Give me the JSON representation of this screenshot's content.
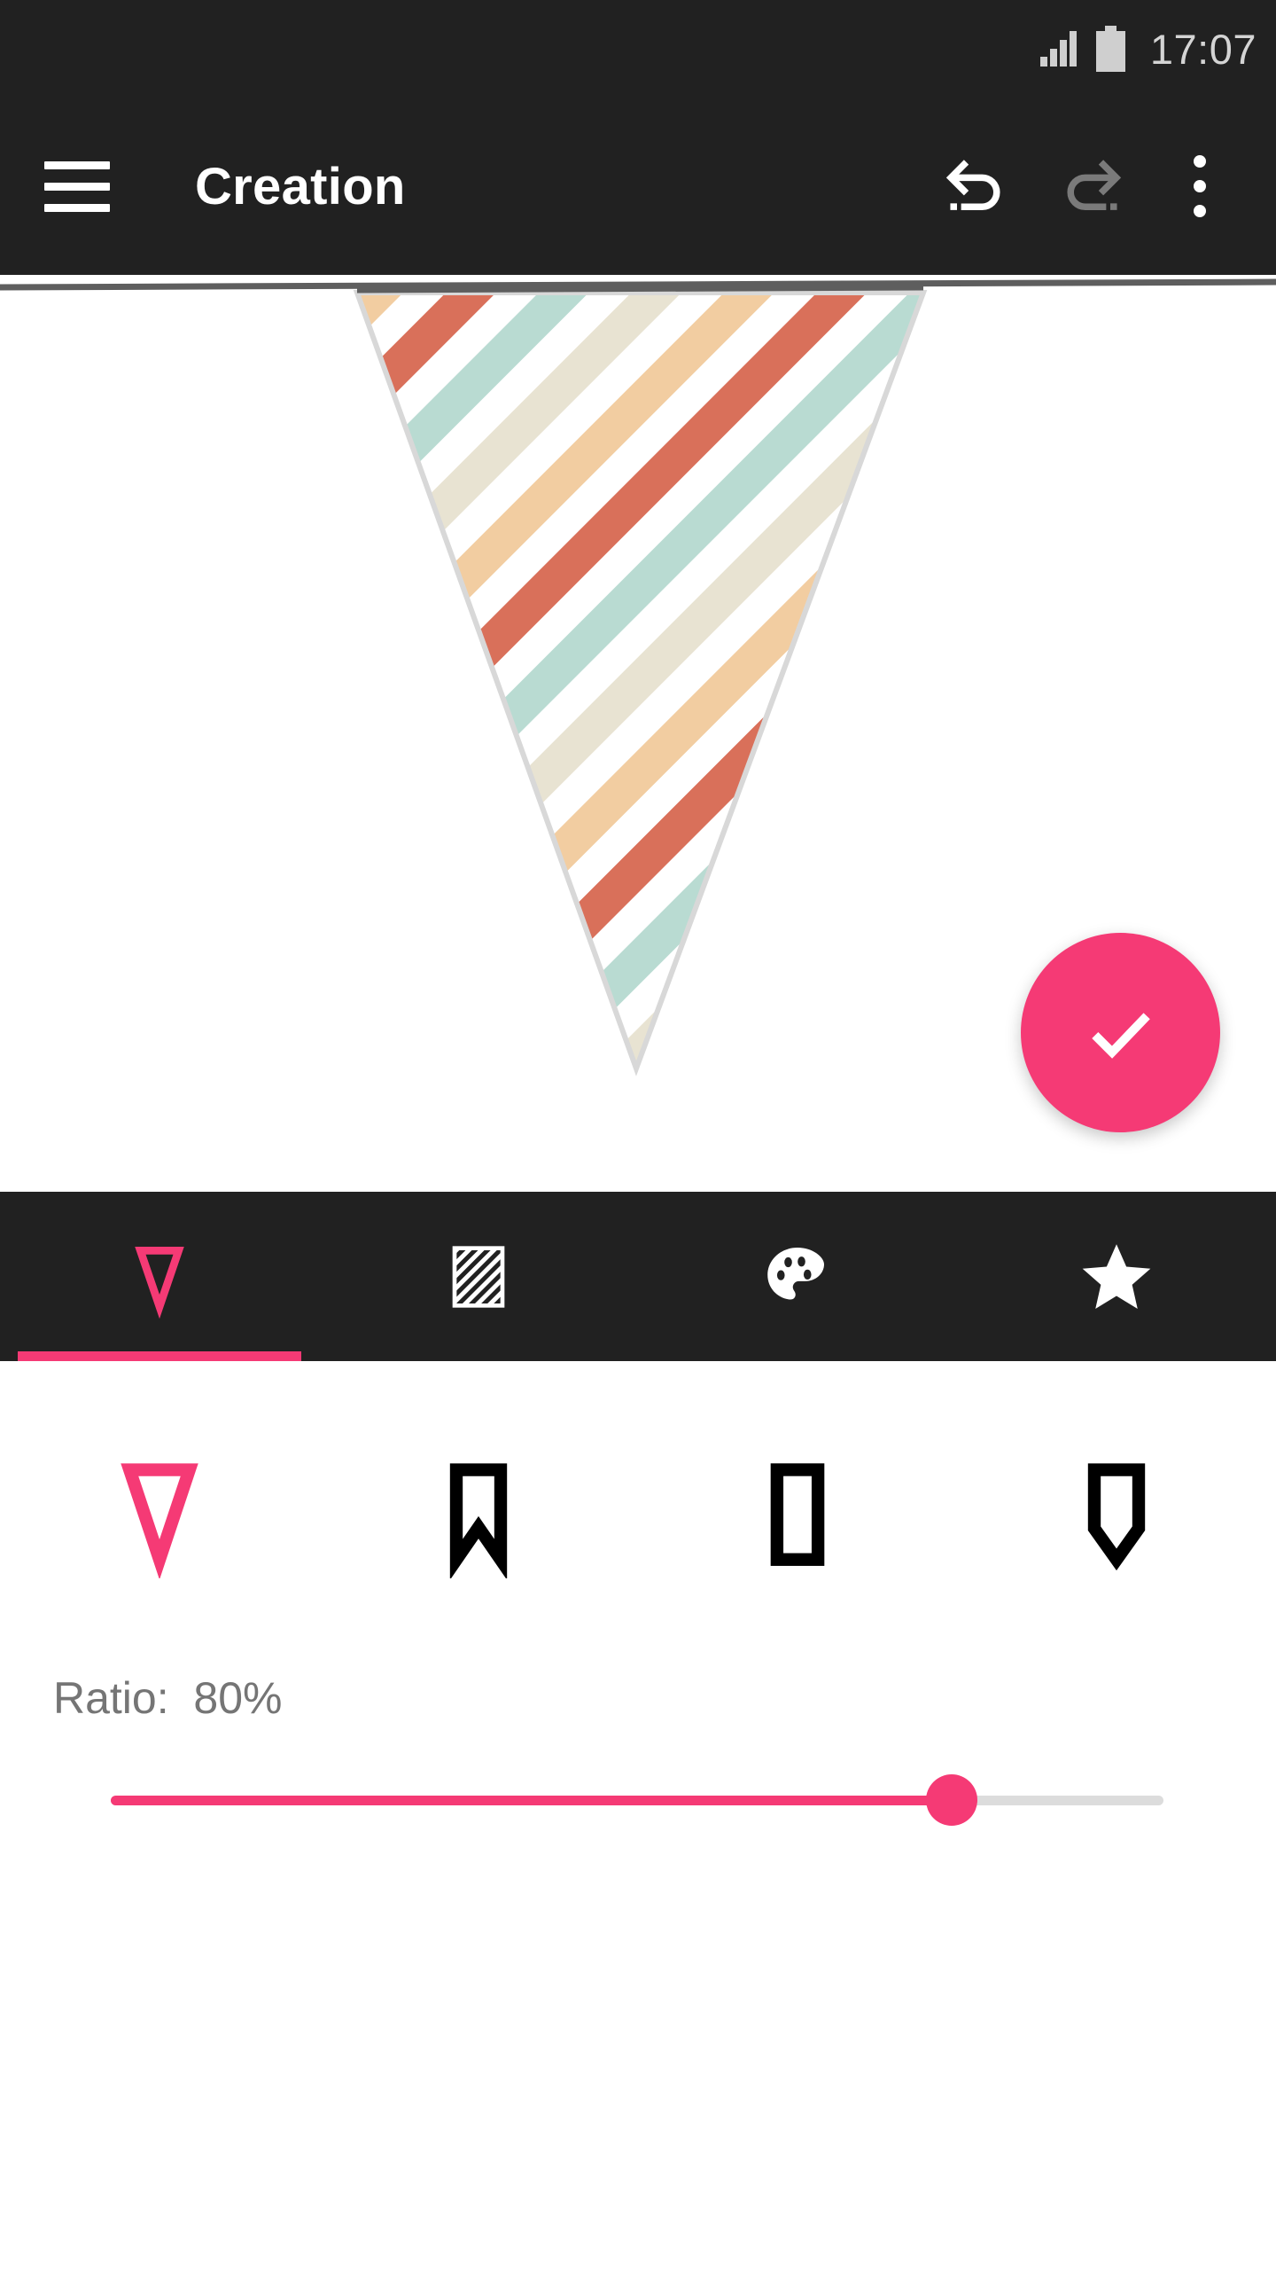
{
  "status_bar": {
    "time": "17:07",
    "signal_icon": "signal-bars-icon",
    "battery_icon": "battery-full-icon",
    "background": "#212121"
  },
  "app_bar": {
    "menu_icon": "hamburger-menu-icon",
    "title": "Creation",
    "actions": [
      {
        "name": "undo-button",
        "icon": "undo-arrow-icon",
        "enabled": true,
        "color": "#ffffff"
      },
      {
        "name": "redo-button",
        "icon": "redo-arrow-icon",
        "enabled": false,
        "color": "#7a7a7a"
      },
      {
        "name": "overflow-menu-button",
        "icon": "three-dots-vertical-icon",
        "enabled": true,
        "color": "#ffffff"
      }
    ]
  },
  "canvas": {
    "background": "#ffffff",
    "string_color": "#5e5e5e",
    "pennant": {
      "shape": "triangle",
      "outline_color": "#d8d8d8",
      "stripe_angle_deg": 45,
      "stripe_colors": [
        "#f2cda1",
        "#ffffff",
        "#d9705a",
        "#ffffff",
        "#b9dbd2",
        "#ffffff",
        "#e8e3d2",
        "#ffffff"
      ]
    }
  },
  "fab": {
    "label": "confirm",
    "icon": "check-icon",
    "color": "#f53a75",
    "icon_color": "#ffffff"
  },
  "tab_bar": {
    "background": "#212121",
    "active_index": 0,
    "indicator_color": "#f53a75",
    "tabs": [
      {
        "name": "tab-shape",
        "icon": "triangle-pennant-icon",
        "active": true,
        "color": "#f53a75"
      },
      {
        "name": "tab-pattern",
        "icon": "diagonal-stripes-icon",
        "active": false,
        "color": "#ffffff"
      },
      {
        "name": "tab-color",
        "icon": "paint-palette-icon",
        "active": false,
        "color": "#ffffff"
      },
      {
        "name": "tab-decoration",
        "icon": "star-icon",
        "active": false,
        "color": "#ffffff"
      }
    ]
  },
  "shape_options": {
    "selected_index": 0,
    "selected_color": "#f53a75",
    "unselected_color": "#000000",
    "options": [
      {
        "name": "shape-option-triangle",
        "icon": "triangle-pennant-icon",
        "selected": true
      },
      {
        "name": "shape-option-swallowtail",
        "icon": "swallowtail-pennant-icon",
        "selected": false
      },
      {
        "name": "shape-option-rectangle",
        "icon": "rectangle-pennant-icon",
        "selected": false
      },
      {
        "name": "shape-option-pointed",
        "icon": "pointed-pennant-icon",
        "selected": false
      }
    ]
  },
  "ratio_control": {
    "label": "Ratio:  80%",
    "name_text": "Ratio:",
    "value_text": "80%",
    "value": 80,
    "min": 0,
    "max": 100,
    "track_color": "#dcdcdc",
    "fill_color": "#f53a75",
    "thumb_color": "#f53a75"
  }
}
